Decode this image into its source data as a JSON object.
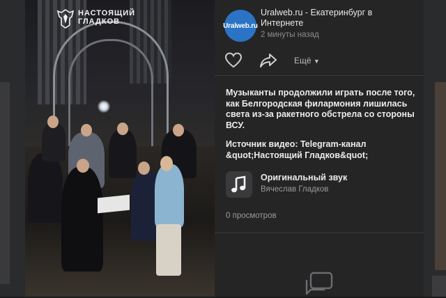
{
  "video": {
    "channel_logo": "eagle-crest-icon",
    "channel_name_line1": "НАСТОЯЩИЙ",
    "channel_name_line2": "ГЛАДКОВ"
  },
  "post": {
    "avatar_text": "Uralweb.ru",
    "author": "Uralweb.ru - Екатеринбург в Интернете",
    "time": "2 минуты назад",
    "actions": {
      "like_icon": "heart-icon",
      "share_icon": "share-arrow-icon",
      "more_label": "Ещё",
      "more_icon": "chevron-down-icon"
    },
    "caption": "Музыканты продолжили играть после того, как Белгородская филармония лишилась света из-за ракетного обстрела со стороны ВСУ.",
    "source": "Источник видео: Telegram-канал &quot;Настоящий Гладков&quot;",
    "sound": {
      "icon": "music-note-icon",
      "title": "Оригинальный звук",
      "author": "Вячеслав Гладков"
    },
    "views": "0 просмотров",
    "comments_icon": "comments-icon"
  },
  "colors": {
    "panel_bg": "#252526",
    "page_bg": "#1b1b1c",
    "avatar_bg": "#2b73c4",
    "text_primary": "#ececec",
    "text_secondary": "#9a9a9d"
  }
}
